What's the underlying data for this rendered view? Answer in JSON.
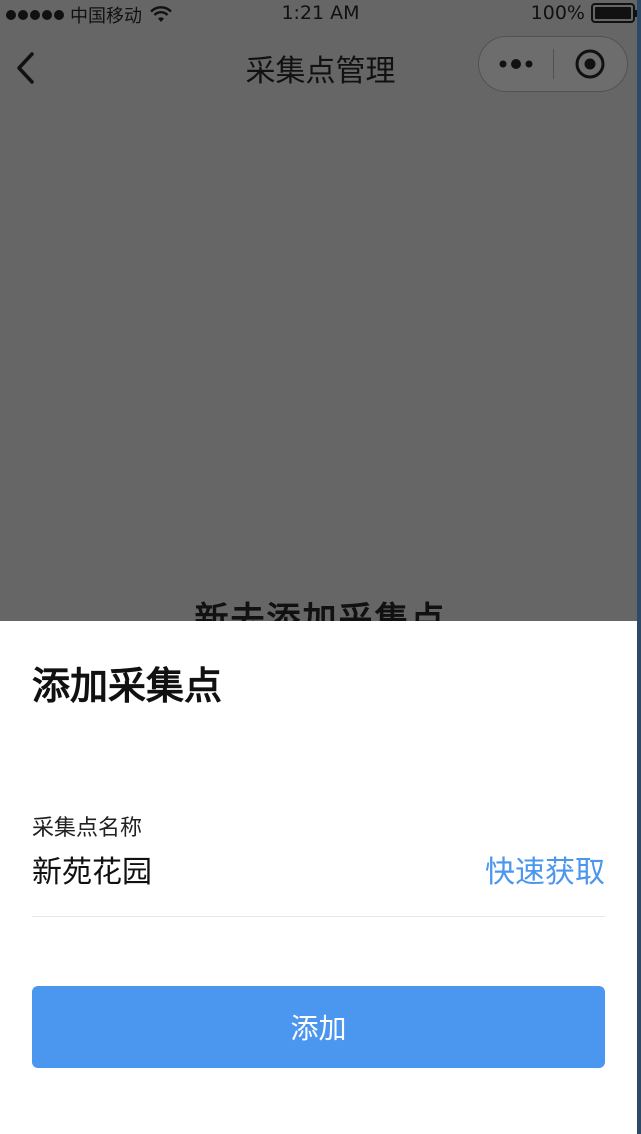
{
  "status_bar": {
    "carrier": "中国移动",
    "time": "1:21 AM",
    "battery": "100%"
  },
  "nav": {
    "title": "采集点管理"
  },
  "background": {
    "heading": "新去添加采集点"
  },
  "sheet": {
    "title": "添加采集点",
    "field_label": "采集点名称",
    "field_value": "新苑花园",
    "quick_fetch": "快速获取",
    "add_label": "添加"
  },
  "colors": {
    "accent": "#4b96ee",
    "overlay": "#666666"
  }
}
